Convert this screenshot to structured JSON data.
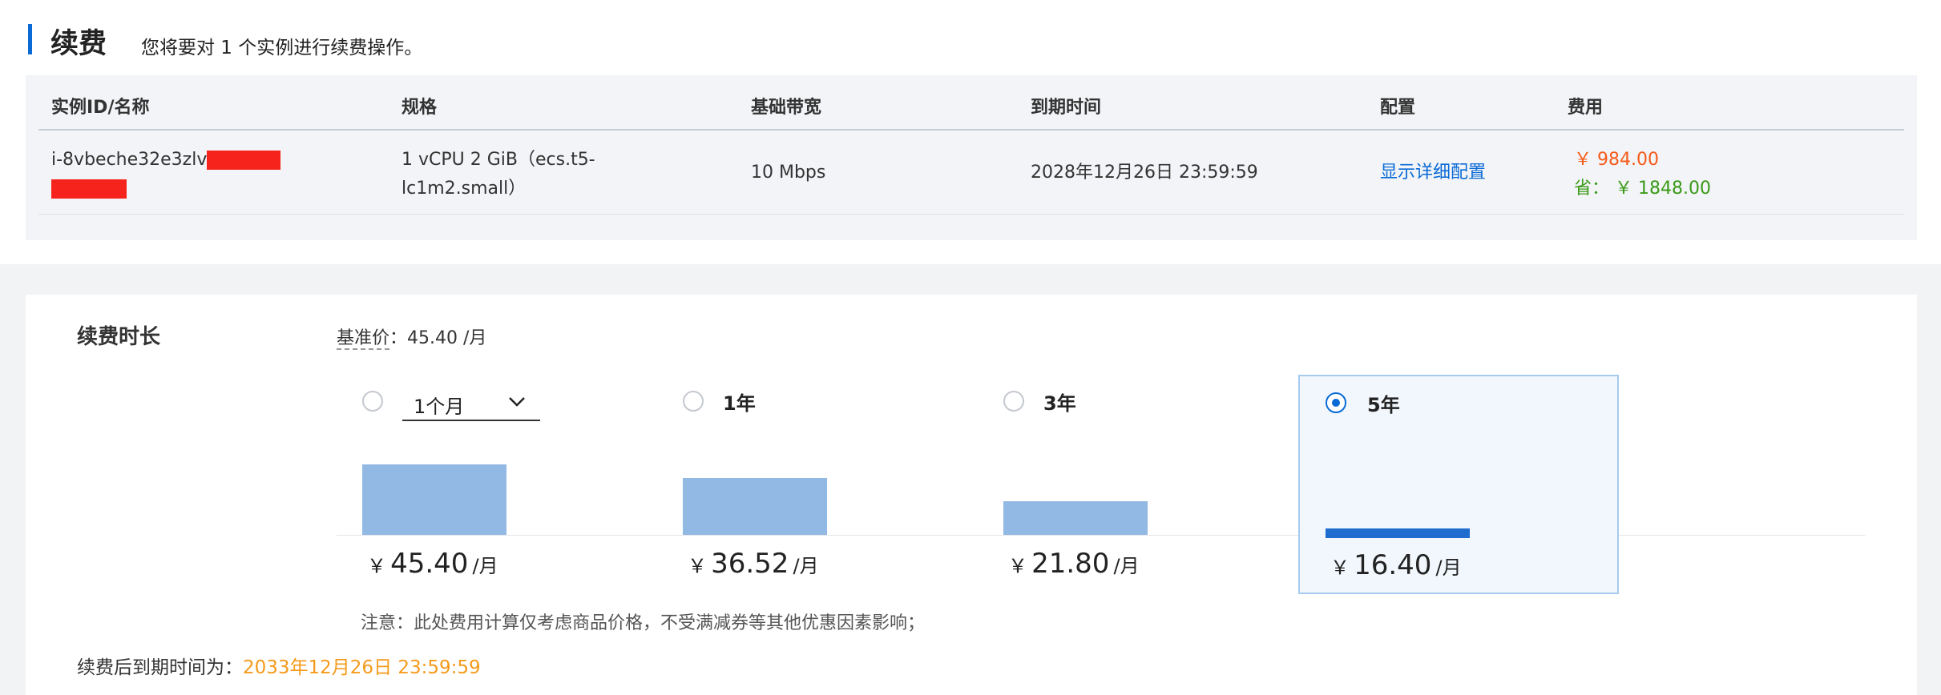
{
  "header": {
    "title": "续费",
    "subtitle": "您将要对 1 个实例进行续费操作。"
  },
  "table": {
    "columns": [
      "实例ID/名称",
      "规格",
      "基础带宽",
      "到期时间",
      "配置",
      "费用"
    ],
    "row": {
      "instance_id": "i-8vbeche32e3zlv",
      "spec_line1": "1 vCPU 2 GiB（ecs.t5-",
      "spec_line2": "lc1m2.small）",
      "bandwidth": "10 Mbps",
      "expire_time": "2028年12月26日 23:59:59",
      "config_link": "显示详细配置",
      "fee_price": "￥ 984.00",
      "fee_save_label": "省：",
      "fee_save_value": "￥ 1848.00"
    }
  },
  "renewal": {
    "label": "续费时长",
    "base_price_label": "基准价",
    "base_price_value": "：45.40 /月",
    "currency": "￥",
    "per_month": "/月",
    "selected_index": 3,
    "options": [
      {
        "label": "1个月",
        "price": "45.40",
        "is_select": true
      },
      {
        "label": "1年",
        "price": "36.52"
      },
      {
        "label": "3年",
        "price": "21.80"
      },
      {
        "label": "5年",
        "price": "16.40"
      }
    ],
    "note": "注意：此处费用计算仅考虑商品价格，不受满减券等其他优惠因素影响；",
    "expire_label": "续费后到期时间为：",
    "expire_value": "2033年12月26日 23:59:59"
  },
  "chart_data": {
    "type": "bar",
    "categories": [
      "1个月",
      "1年",
      "3年",
      "5年"
    ],
    "values": [
      45.4,
      36.52,
      21.8,
      16.4
    ]
  },
  "colors": {
    "accent": "#0a6ad6",
    "bar": "#92b8e4",
    "bar_selected": "#1f6dcf",
    "price_orange": "#f65a19",
    "save_green": "#3a9a17",
    "expire_orange": "#f59a1b"
  }
}
